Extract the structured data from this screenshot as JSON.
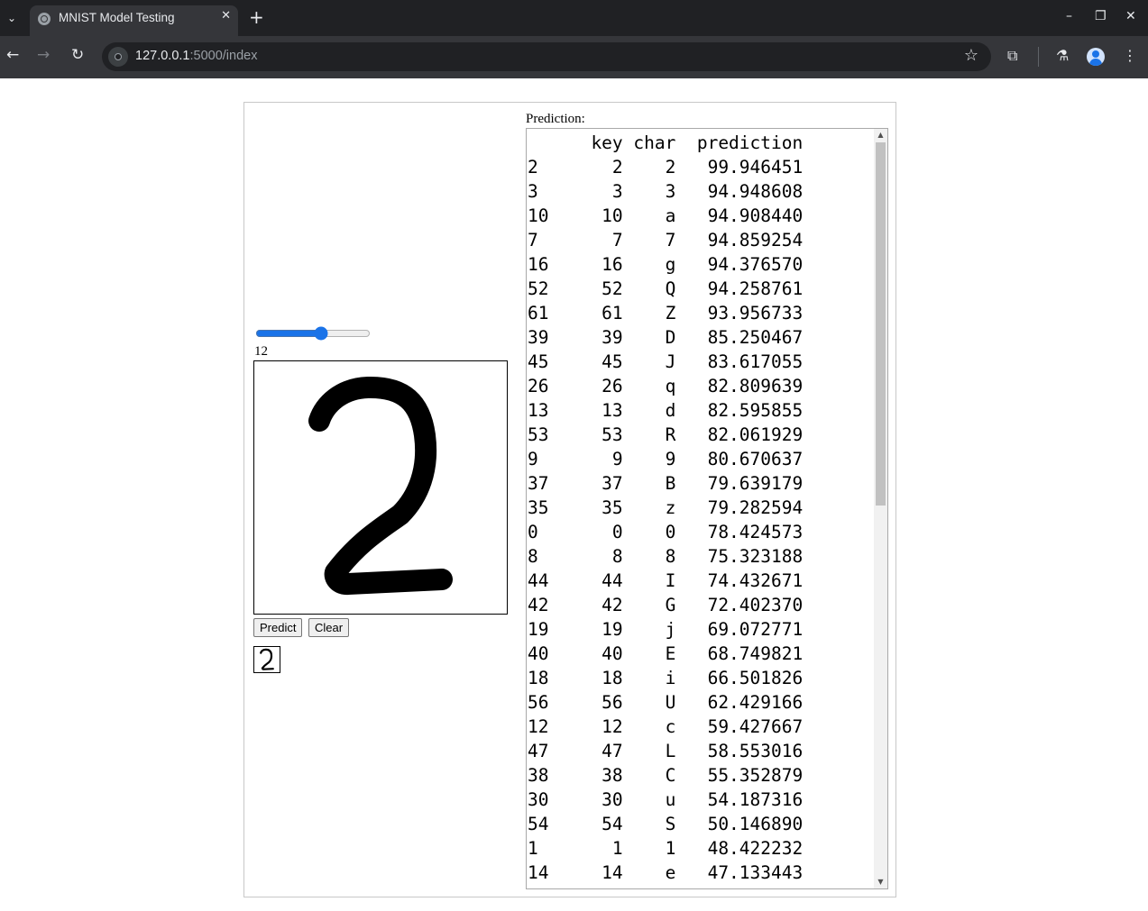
{
  "browser": {
    "tab_title": "MNIST Model Testing",
    "tab_close_icon": "close-icon",
    "new_tab_glyph": "+",
    "tab_list_glyph": "⌄",
    "url_host": "127.0.0.1",
    "url_path": ":5000/index",
    "icons": {
      "back": "←",
      "forward": "→",
      "reload": "↻",
      "star": "☆",
      "minimize": "–",
      "restore": "❐",
      "close": "✕",
      "close_tab": "✕",
      "extensions": "⧉",
      "labs": "⚗",
      "menu": "⋮"
    }
  },
  "page": {
    "brush_slider_value": 12,
    "brush_slider_max": 20,
    "brush_size_label": "12",
    "predict_label": "Predict",
    "clear_label": "Clear",
    "prediction_label": "Prediction:",
    "table": {
      "headers": [
        "key",
        "char",
        "prediction"
      ],
      "rows": [
        [
          "2",
          "2",
          "2",
          "99.946451"
        ],
        [
          "3",
          "3",
          "3",
          "94.948608"
        ],
        [
          "10",
          "10",
          "a",
          "94.908440"
        ],
        [
          "7",
          "7",
          "7",
          "94.859254"
        ],
        [
          "16",
          "16",
          "g",
          "94.376570"
        ],
        [
          "52",
          "52",
          "Q",
          "94.258761"
        ],
        [
          "61",
          "61",
          "Z",
          "93.956733"
        ],
        [
          "39",
          "39",
          "D",
          "85.250467"
        ],
        [
          "45",
          "45",
          "J",
          "83.617055"
        ],
        [
          "26",
          "26",
          "q",
          "82.809639"
        ],
        [
          "13",
          "13",
          "d",
          "82.595855"
        ],
        [
          "53",
          "53",
          "R",
          "82.061929"
        ],
        [
          "9",
          "9",
          "9",
          "80.670637"
        ],
        [
          "37",
          "37",
          "B",
          "79.639179"
        ],
        [
          "35",
          "35",
          "z",
          "79.282594"
        ],
        [
          "0",
          "0",
          "0",
          "78.424573"
        ],
        [
          "8",
          "8",
          "8",
          "75.323188"
        ],
        [
          "44",
          "44",
          "I",
          "74.432671"
        ],
        [
          "42",
          "42",
          "G",
          "72.402370"
        ],
        [
          "19",
          "19",
          "j",
          "69.072771"
        ],
        [
          "40",
          "40",
          "E",
          "68.749821"
        ],
        [
          "18",
          "18",
          "i",
          "66.501826"
        ],
        [
          "56",
          "56",
          "U",
          "62.429166"
        ],
        [
          "12",
          "12",
          "c",
          "59.427667"
        ],
        [
          "47",
          "47",
          "L",
          "58.553016"
        ],
        [
          "38",
          "38",
          "C",
          "55.352879"
        ],
        [
          "30",
          "30",
          "u",
          "54.187316"
        ],
        [
          "54",
          "54",
          "S",
          "50.146890"
        ],
        [
          "1",
          "1",
          "1",
          "48.422232"
        ],
        [
          "14",
          "14",
          "e",
          "47.133443"
        ]
      ]
    }
  },
  "colors": {
    "chrome_dark": "#202124",
    "chrome_toolbar": "#35363a",
    "accent": "#1a73e8"
  }
}
